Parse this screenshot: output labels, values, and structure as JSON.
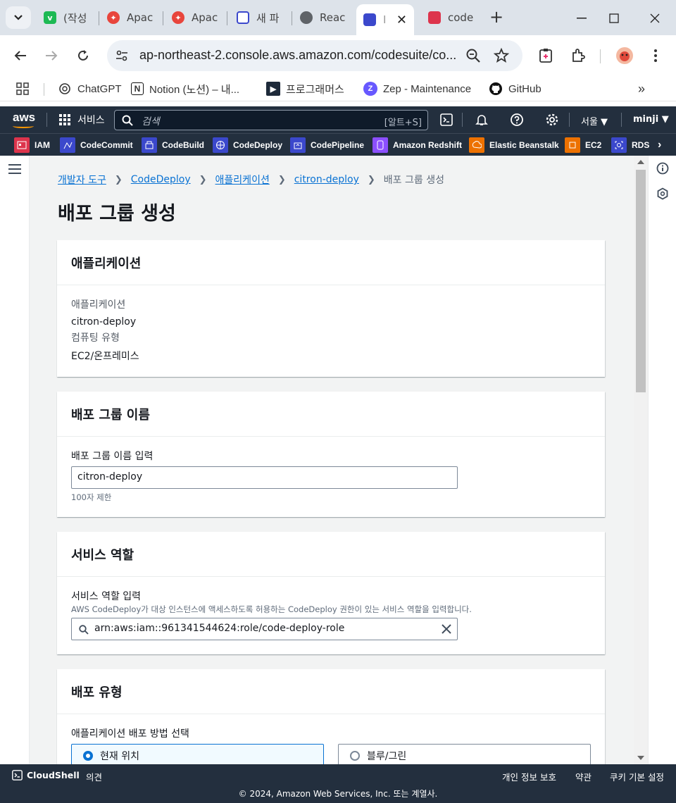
{
  "browser": {
    "tabs": [
      {
        "title": "(작성",
        "fav_color": "#1db954",
        "fav_letter": "v"
      },
      {
        "title": "Apac",
        "fav_color": "#e8453c",
        "fav_letter": "✦"
      },
      {
        "title": "Apac",
        "fav_color": "#e8453c",
        "fav_letter": "✦"
      },
      {
        "title": "새 파",
        "fav_color": "#3b48cc",
        "fav_letter": ""
      },
      {
        "title": "Reac",
        "fav_color": "#5f6368",
        "fav_letter": ""
      },
      {
        "title": "I",
        "fav_color": "#3b48cc",
        "fav_letter": ""
      },
      {
        "title": "code",
        "fav_color": "#dd344c",
        "fav_letter": ""
      }
    ],
    "url": "ap-northeast-2.console.aws.amazon.com/codesuite/co...",
    "bookmarks": [
      {
        "label": "ChatGPT",
        "icon": "chatgpt-icon"
      },
      {
        "label": "Notion (노션) – 내...",
        "icon": "notion-icon"
      },
      {
        "label": "프로그래머스",
        "icon": "programmers-icon"
      },
      {
        "label": "Zep - Maintenance",
        "icon": "zep-icon"
      },
      {
        "label": "GitHub",
        "icon": "github-icon"
      }
    ]
  },
  "aws": {
    "services_label": "서비스",
    "search_placeholder": "검색",
    "search_shortcut": "[알트+S]",
    "region": "서울 ▼",
    "user": "minji ▼",
    "favorites": [
      {
        "label": "IAM",
        "color": "#dd344c"
      },
      {
        "label": "CodeCommit",
        "color": "#3b48cc"
      },
      {
        "label": "CodeBuild",
        "color": "#3b48cc"
      },
      {
        "label": "CodeDeploy",
        "color": "#3b48cc"
      },
      {
        "label": "CodePipeline",
        "color": "#3b48cc"
      },
      {
        "label": "Amazon Redshift",
        "color": "#8c4fff"
      },
      {
        "label": "Elastic Beanstalk",
        "color": "#ed7100"
      },
      {
        "label": "EC2",
        "color": "#ed7100"
      },
      {
        "label": "RDS",
        "color": "#3b48cc"
      }
    ]
  },
  "breadcrumb": {
    "items": [
      "개발자 도구",
      "CodeDeploy",
      "애플리케이션",
      "citron-deploy"
    ],
    "current": "배포 그룹 생성"
  },
  "page_title": "배포 그룹 생성",
  "application_panel": {
    "title": "애플리케이션",
    "app_label": "애플리케이션",
    "app_value": "citron-deploy",
    "compute_label": "컴퓨팅 유형",
    "compute_value": "EC2/온프레미스"
  },
  "group_name_panel": {
    "title": "배포 그룹 이름",
    "field_label": "배포 그룹 이름 입력",
    "value": "citron-deploy",
    "constraint": "100자 제한"
  },
  "service_role_panel": {
    "title": "서비스 역할",
    "field_label": "서비스 역할 입력",
    "description": "AWS CodeDeploy가 대상 인스턴스에 액세스하도록 허용하는 CodeDeploy 권한이 있는 서비스 역할을 입력합니다.",
    "value": "arn:aws:iam::961341544624:role/code-deploy-role"
  },
  "deploy_type_panel": {
    "title": "배포 유형",
    "field_label": "애플리케이션 배포 방법 선택",
    "options": [
      {
        "label": "현재 위치",
        "selected": true
      },
      {
        "label": "블루/그린",
        "selected": false
      }
    ]
  },
  "footer": {
    "cloudshell": "CloudShell",
    "feedback": "의견",
    "privacy": "개인 정보 보호",
    "terms": "약관",
    "cookies": "쿠키 기본 설정",
    "copyright": "© 2024, Amazon Web Services, Inc. 또는 계열사."
  },
  "colors": {
    "aws_nav": "#232f3e",
    "link": "#0972d3",
    "console_bg": "#f2f3f3",
    "aws_orange": "#ff9900"
  }
}
